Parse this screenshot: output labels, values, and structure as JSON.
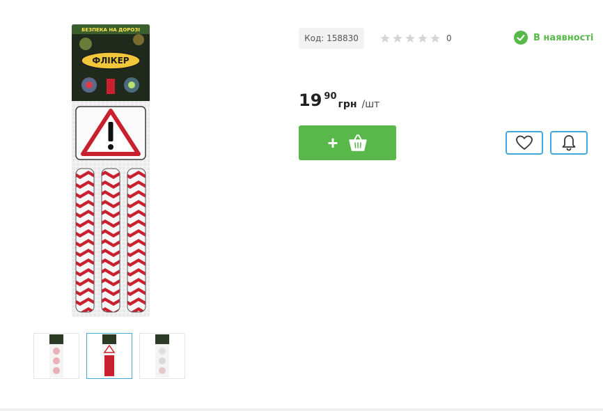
{
  "product": {
    "image_alt": "Флікер",
    "thumbnails": [
      "thumb-1",
      "thumb-2",
      "thumb-3"
    ],
    "active_thumbnail": 1
  },
  "meta": {
    "code_label": "Код: 158830",
    "rating_value": 0,
    "rating_max": 5,
    "rating_count": "0",
    "stock": "В наявності"
  },
  "price": {
    "integer": "19",
    "decimal": "90",
    "currency": "грн",
    "unit": "/шт"
  },
  "actions": {
    "add_to_cart_plus": "+",
    "cart_icon": "basket-icon",
    "wishlist_icon": "heart-icon",
    "notify_icon": "bell-icon"
  },
  "colors": {
    "accent_green": "#58b84a",
    "accent_blue": "#3fa8d8",
    "star_empty": "#d5d5d5"
  }
}
